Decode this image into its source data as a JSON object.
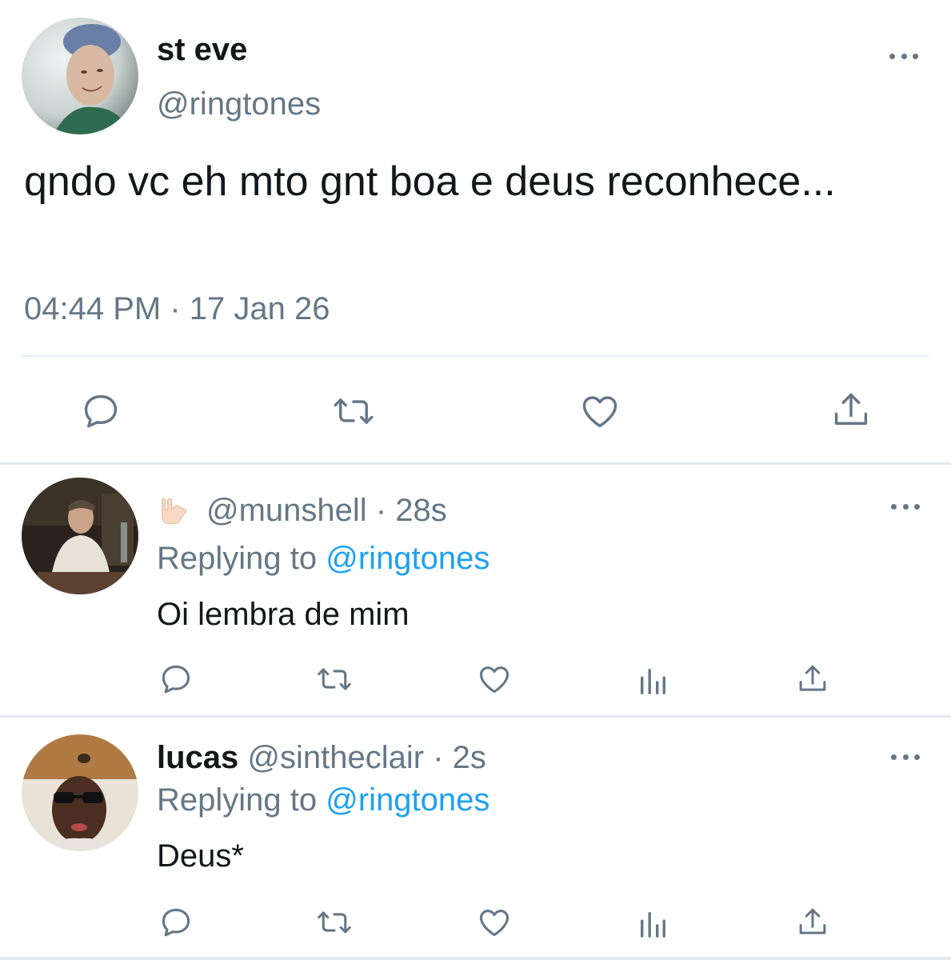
{
  "main_tweet": {
    "display_name": "st eve",
    "handle": "@ringtones",
    "text": "qndo vc eh mto gnt boa e deus reconhece...",
    "timestamp": "04:44 PM · 17 Jan 26",
    "actions": [
      "reply-icon",
      "retweet-icon",
      "like-icon",
      "share-icon"
    ]
  },
  "replies": [
    {
      "display_name": "",
      "emoji": "love-you-gesture-emoji",
      "handle": "@munshell",
      "time": "· 28s",
      "replying_prefix": "Replying to",
      "replying_to": "@ringtones",
      "text": "Oi lembra de mim",
      "actions": [
        "reply-icon",
        "retweet-icon",
        "like-icon",
        "analytics-icon",
        "share-icon"
      ]
    },
    {
      "display_name": "lucas",
      "handle": "@sintheclair",
      "time": "· 2s",
      "replying_prefix": "Replying to",
      "replying_to": "@ringtones",
      "text": "Deus*",
      "actions": [
        "reply-icon",
        "retweet-icon",
        "like-icon",
        "analytics-icon",
        "share-icon"
      ]
    }
  ],
  "colors": {
    "text": "#14171a",
    "secondary": "#657786",
    "link": "#1da1f2",
    "divider": "#e1e8ed"
  }
}
